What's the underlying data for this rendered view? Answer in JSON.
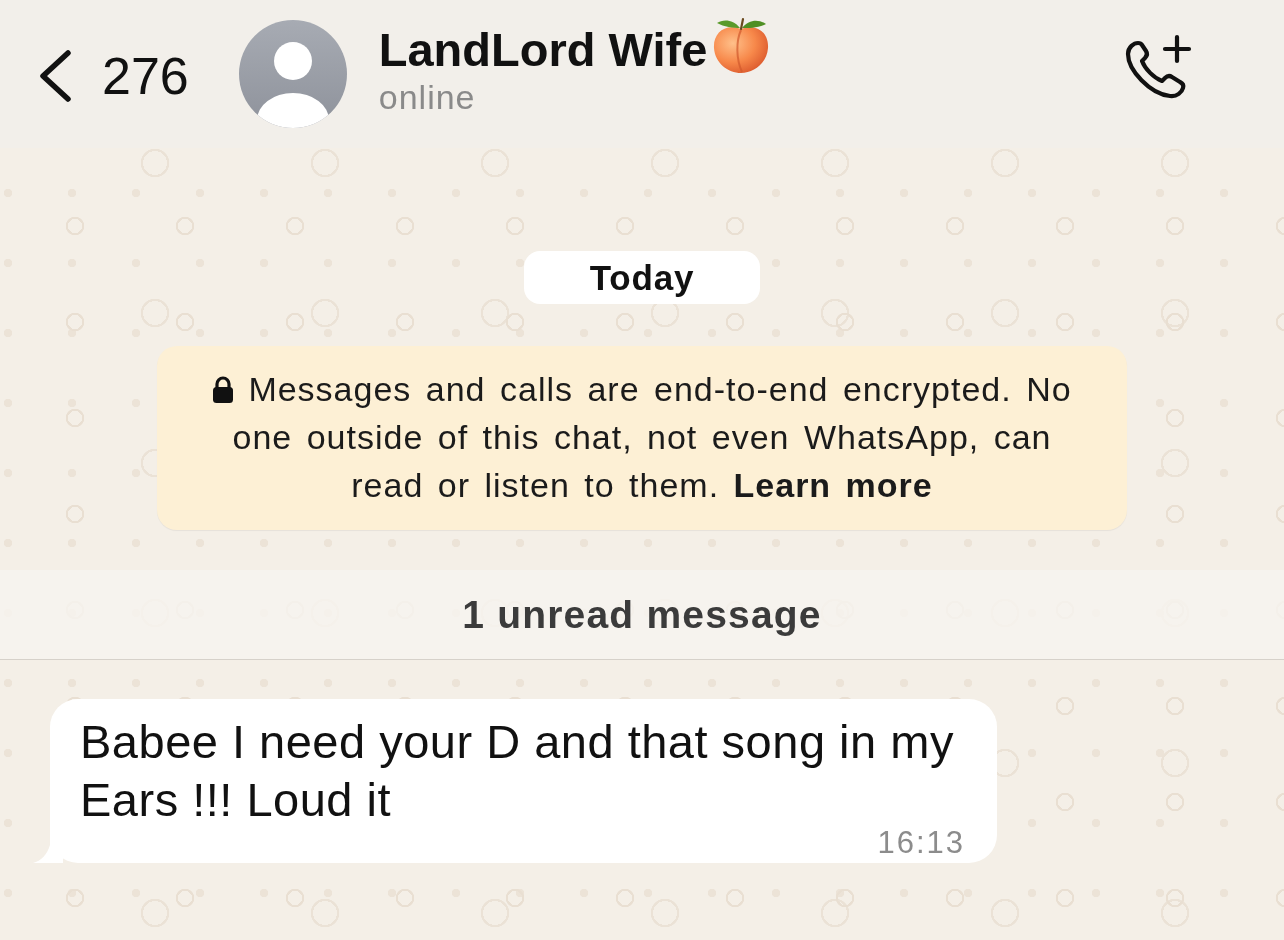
{
  "header": {
    "back_count": "276",
    "contact_name": "LandLord Wife",
    "status": "online"
  },
  "chat": {
    "date_label": "Today",
    "encryption_notice": {
      "text": "Messages and calls are end-to-end encrypted. No one outside of this chat, not even WhatsApp, can read or listen to them.",
      "link": "Learn more"
    },
    "unread_divider": "1 unread message",
    "messages": [
      {
        "kind": "incoming",
        "text": "Babee I need your D and that song in my Ears !!! Loud it",
        "time": "16:13"
      }
    ]
  }
}
